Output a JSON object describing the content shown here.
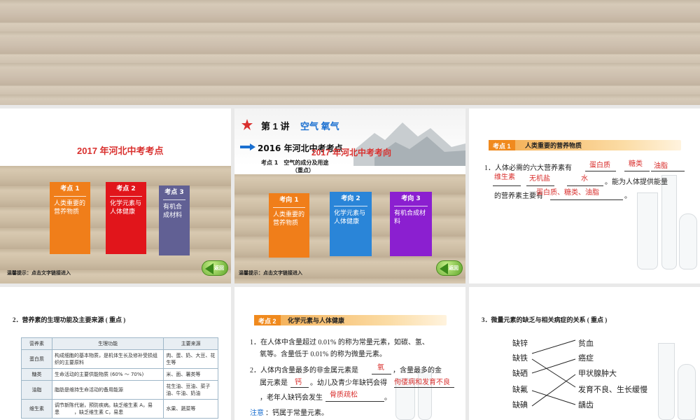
{
  "slide1": {
    "title": "2017 年河北中考考点",
    "boxes": [
      {
        "head": "考点 1",
        "body": "人类重要的营养物质",
        "color": "#f07e1a"
      },
      {
        "head": "考点 2",
        "body": "化学元素与人体健康",
        "color": "#e1151b"
      },
      {
        "head": "考点 3",
        "body": "有机合成材料",
        "color": "#616094"
      }
    ],
    "tip": "温馨提示：点击文字链接进入",
    "back": "返回"
  },
  "slide2": {
    "lecture": "第 1 讲",
    "lecture_topic": "空气  氧气",
    "year_title": "2016 年河北中考考点",
    "overlay_title": "2017 年河北中考考向",
    "point_line1": "考点 1　空气的成分及用途",
    "point_line2": "（重点）",
    "boxes": [
      {
        "head": "考向 1",
        "body": "人类重要的营养物质",
        "color": "#f07e1a"
      },
      {
        "head": "考向 2",
        "body": "化学元素与人体健康",
        "color": "#2a85d8"
      },
      {
        "head": "考向 3",
        "body": "有机合成材料",
        "color": "#8b1fd0"
      }
    ],
    "tip": "温馨提示：点击文字链接进入",
    "back": "返回"
  },
  "slide3": {
    "tag": "考点 1",
    "heading": "人类重要的营养物质",
    "line1": "1．人体必需的六大营养素有",
    "line2_end": "。能为人体提供能量",
    "line3": "的营养素主要有",
    "line3_end": "。",
    "answers": {
      "a1": "蛋白质",
      "a2": "糖类",
      "a3": "油脂",
      "a4": "维生素",
      "a5": "无机盐",
      "a6": "水",
      "a7": "蛋白质、糖类、油脂"
    }
  },
  "slide4": {
    "heading": "2．营养素的生理功能及主要来源 ( 重点 )",
    "columns": [
      "营养素",
      "生理功能",
      "主要来源"
    ],
    "rows": [
      [
        "蛋白质",
        "构成细胞的基本物质，是机体生长及修补受损组织的主要原料",
        "肉、蛋、奶、大豆、花生等"
      ],
      [
        "糖类",
        "生命活动的主要供能物质 (60% ～ 70%)",
        "米、面、薯类等"
      ],
      [
        "油脂",
        "脂肪是维持生命活动的备用能源",
        "花生油、豆油、菜子油、牛油、奶油"
      ],
      [
        "维生素",
        "调节新陈代谢，预防疾病。缺乏维生素 A，易患　　　，缺乏维生素 C，易患",
        "水果、蔬菜等"
      ]
    ]
  },
  "slide5": {
    "tag": "考点 2",
    "heading": "化学元素与人体健康",
    "p1_line1": "1．在人体中含量超过 0.01% 的称为常量元素，如碳、氢、",
    "p1_line2": "氧等。含量低于 0.01% 的称为微量元素。",
    "p2_line1a": "2．人体内含量最多的非金属元素是",
    "p2_line1b": "，含量最多的金",
    "p2_line2a": "属元素是",
    "p2_line2b": "。幼儿及青少年缺钙会得",
    "p2_line3a": "，老年人缺钙会发生",
    "p2_line3b": "。",
    "note_label": "注意",
    "note_text": "：钙属于常量元素。",
    "answers": {
      "oxygen": "氧",
      "calcium": "钙",
      "child": "佝偻病和发育不良",
      "elder": "骨质疏松"
    }
  },
  "slide6": {
    "heading": "3．微量元素的缺乏与相关病症的关系 ( 重点 )",
    "left": [
      "缺锌",
      "缺铁",
      "缺硒",
      "缺氟",
      "缺碘"
    ],
    "right": [
      "贫血",
      "癌症",
      "甲状腺肿大",
      "发育不良、生长缓慢",
      "龋齿"
    ]
  }
}
